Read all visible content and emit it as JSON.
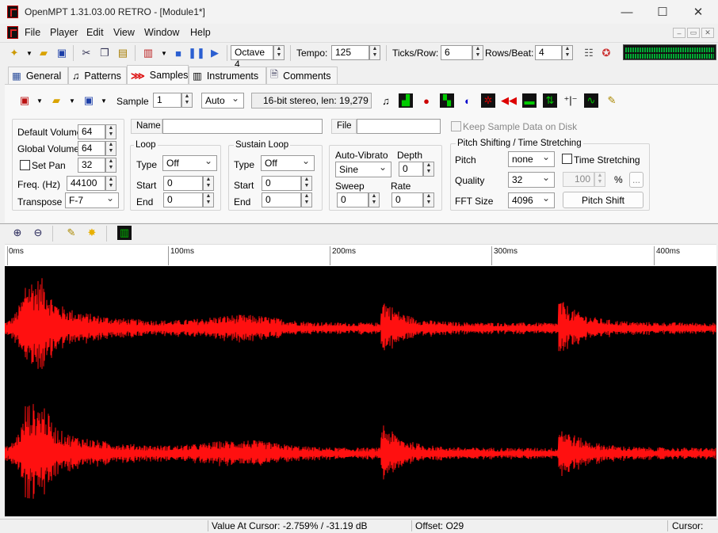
{
  "window": {
    "title": "OpenMPT 1.31.03.00 RETRO - [Module1*]",
    "min_glyph": "—",
    "max_glyph": "☐",
    "close_glyph": "✕"
  },
  "menu": {
    "items": [
      "File",
      "Player",
      "Edit",
      "View",
      "Window",
      "Help"
    ]
  },
  "mdi": {
    "min": "‒",
    "restore": "▭",
    "close": "✕"
  },
  "toolbar": {
    "octave": "Octave 4",
    "tempo_label": "Tempo:",
    "tempo": "125",
    "ticks_label": "Ticks/Row:",
    "ticks": "6",
    "rows_label": "Rows/Beat:",
    "rows": "4"
  },
  "tabs": [
    {
      "label": "General",
      "icon": "general-icon"
    },
    {
      "label": "Patterns",
      "icon": "note-icon"
    },
    {
      "label": "Samples",
      "icon": "samples-icon"
    },
    {
      "label": "Instruments",
      "icon": "piano-icon"
    },
    {
      "label": "Comments",
      "icon": "document-icon"
    }
  ],
  "samples": {
    "sample_label": "Sample",
    "sample_num": "1",
    "format": "Auto",
    "info": "16-bit stereo, len: 19,279",
    "default_volume_label": "Default Volume",
    "default_volume": "64",
    "global_volume_label": "Global Volume",
    "global_volume": "64",
    "set_pan_label": "Set Pan",
    "set_pan": "32",
    "freq_label": "Freq. (Hz)",
    "freq": "44100",
    "transpose_label": "Transpose",
    "transpose": "F-7",
    "name_label": "Name",
    "name_value": "",
    "file_label": "File",
    "file_value": "",
    "keep_on_disk": "Keep Sample Data on Disk",
    "loop": {
      "title": "Loop",
      "type_label": "Type",
      "type": "Off",
      "start_label": "Start",
      "start": "0",
      "end_label": "End",
      "end": "0"
    },
    "sustain": {
      "title": "Sustain Loop",
      "type_label": "Type",
      "type": "Off",
      "start_label": "Start",
      "start": "0",
      "end_label": "End",
      "end": "0"
    },
    "vibrato": {
      "title": "Auto-Vibrato",
      "waveform": "Sine",
      "depth_label": "Depth",
      "depth": "0",
      "sweep_label": "Sweep",
      "sweep": "0",
      "rate_label": "Rate",
      "rate": "0"
    },
    "pitch": {
      "title": "Pitch Shifting / Time Stretching",
      "pitch_label": "Pitch",
      "pitch": "none",
      "time_stretch": "Time Stretching",
      "quality_label": "Quality",
      "quality": "32",
      "stretch_amount": "100",
      "percent": "%",
      "ellipsis": "...",
      "fft_label": "FFT Size",
      "fft": "4096",
      "pitch_shift_button": "Pitch Shift"
    }
  },
  "ruler": {
    "labels": [
      "0ms",
      "100ms",
      "200ms",
      "300ms",
      "400ms"
    ]
  },
  "status": {
    "value_at_cursor": "Value At Cursor: -2.759% / -31.19 dB",
    "offset": "Offset: O29",
    "cursor": "Cursor:"
  },
  "colors": {
    "waveform": "#ff1010",
    "wave_bg": "#000000",
    "vu": "#00aa33"
  }
}
